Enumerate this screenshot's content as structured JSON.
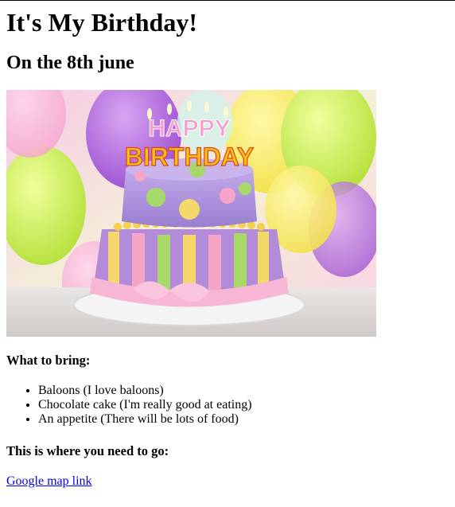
{
  "title": "It's My Birthday!",
  "subtitle": "On the 8th june",
  "image": {
    "description_icon": "birthday-cake-image",
    "candle_text_top": "HAPPY",
    "candle_text_bottom": "BIRTHDAY"
  },
  "bring": {
    "heading": "What to bring:",
    "items": [
      "Baloons (I love baloons)",
      "Chocolate cake (I'm really good at eating)",
      "An appetite (There will be lots of food)"
    ]
  },
  "location": {
    "heading": "This is where you need to go:",
    "link_text": "Google map link"
  },
  "colors": {
    "link": "#0000ee",
    "text": "#000000",
    "background": "#ffffff"
  }
}
